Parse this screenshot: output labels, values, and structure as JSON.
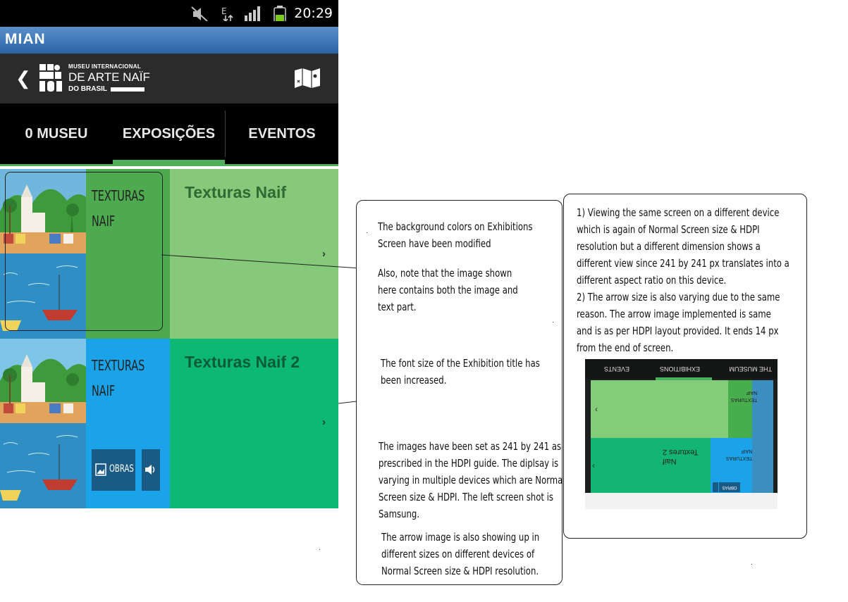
{
  "status_bar": {
    "time": "20:29",
    "icons": [
      "mute-icon",
      "data-transfer-icon",
      "signal-icon",
      "battery-icon"
    ]
  },
  "app": {
    "title": "MIAN"
  },
  "logo": {
    "line1": "MUSEU INTERNACIONAL",
    "line2": "DE ARTE NAÏF",
    "line3": "DO BRASIL"
  },
  "tabs": [
    {
      "label": "0 MUSEU",
      "active": false
    },
    {
      "label": "EXPOSIÇÕES",
      "active": true
    },
    {
      "label": "EVENTOS",
      "active": false
    }
  ],
  "exhibitions": [
    {
      "image_text_1": "TEXTURAS",
      "image_text_2": "NAIF",
      "title": "Texturas Naif",
      "color_image": "#4daa4f",
      "color_bg": "#86c97a"
    },
    {
      "image_text_1": "TEXTURAS",
      "image_text_2": "NAIF",
      "title": "Texturas Naif 2",
      "obras_label": "OBRAS",
      "color_image": "#1aa3e8",
      "color_bg": "#0db874"
    }
  ],
  "annotations": {
    "middle": [
      "The background colors on Exhibitions",
      "Screen have been modified",
      "Also, note that the image shown",
      "here contains both the image and",
      "text part.",
      "The font size of the Exhibition title has",
      "been increased.",
      "The images have been set as 241 by 241 as",
      "prescribed in the HDPI guide. The diplsay is",
      "varying in multiple devices which are Normal",
      "Screen size & HDPI. The left screen shot is",
      "Samsung.",
      "The arrow image is also showing up in",
      "different sizes on different devices of",
      "Normal Screen size & HDPI resolution."
    ],
    "right": [
      "1) Viewing the same screen on a different device",
      "which is again of Normal Screen size & HDPI",
      "resolution but a different dimension shows a",
      "different view since 241 by 241 px translates into a",
      "different aspect ratio on this device.",
      "2) The arrow size is also varying due to the same",
      "reason. The arrow image implemented is same",
      "and is as per HDPI layout provided. It ends 14 px",
      "from the end of screen."
    ]
  },
  "photo": {
    "tabs": [
      "THE MUSEUM",
      "EXHIBITIONS",
      "EVENTS"
    ],
    "row1_text": [
      "TEXTURAS",
      "NAIF"
    ],
    "row2_title": [
      "Naif",
      "Textures 2"
    ],
    "row2_text": [
      "TEXTURAS",
      "NAIF"
    ],
    "obras": "OBRAS"
  }
}
